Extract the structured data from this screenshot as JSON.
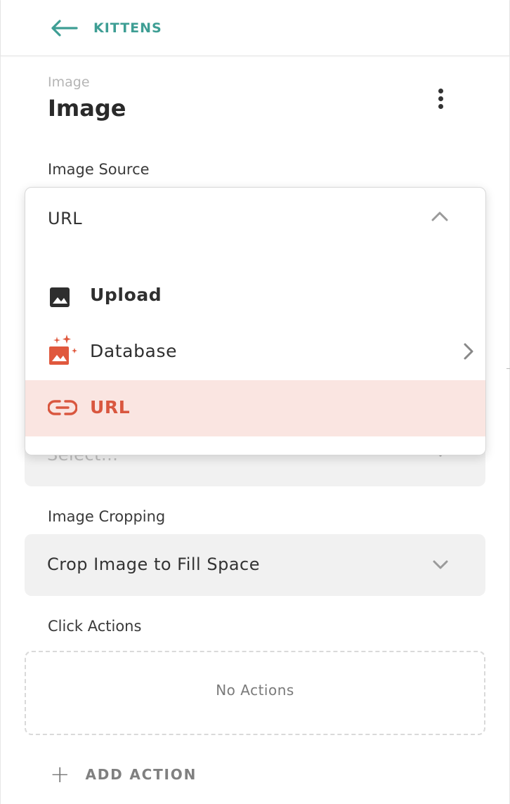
{
  "header": {
    "back_label": "KITTENS"
  },
  "component": {
    "eyebrow": "Image",
    "title": "Image"
  },
  "image_source": {
    "label": "Image Source",
    "selected": "URL",
    "options": [
      {
        "label": "Upload",
        "icon": "image-icon"
      },
      {
        "label": "Database",
        "icon": "magic-image-icon",
        "has_submenu": true
      },
      {
        "label": "URL",
        "icon": "link-icon",
        "selected": true
      }
    ]
  },
  "hidden_select": {
    "placeholder": "Select..."
  },
  "image_cropping": {
    "label": "Image Cropping",
    "value": "Crop Image to Fill Space"
  },
  "click_actions": {
    "label": "Click Actions",
    "empty_text": "No Actions",
    "add_label": "ADD ACTION"
  },
  "colors": {
    "accent": "#3e9e94",
    "selected_text": "#d9573f",
    "selected_bg": "#fae5e1"
  }
}
